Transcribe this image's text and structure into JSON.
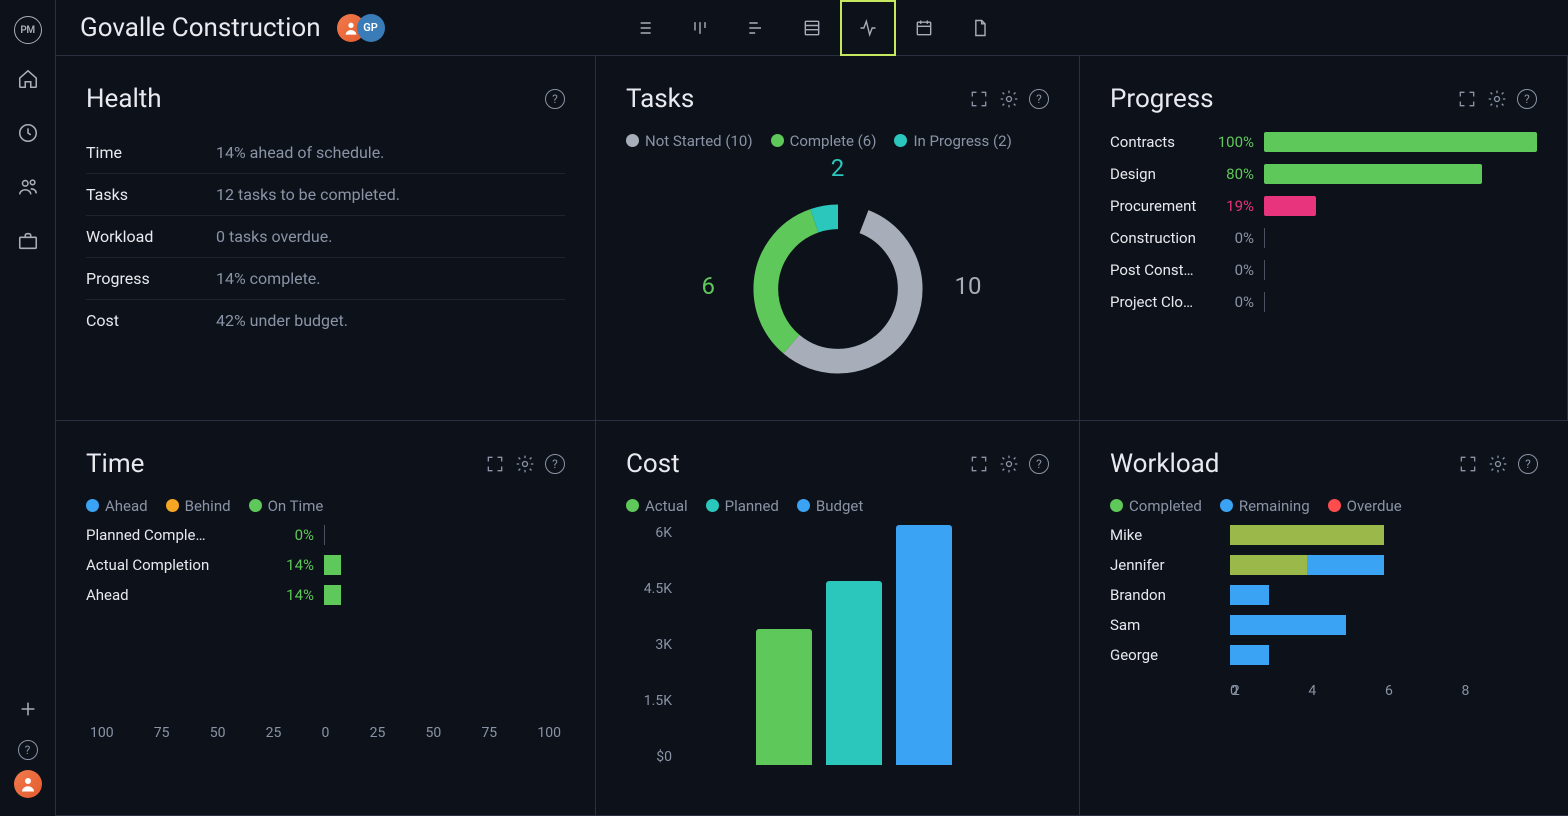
{
  "app": {
    "logo": "PM",
    "project_title": "Govalle Construction",
    "avatar2": "GP"
  },
  "colors": {
    "green": "#5fc85a",
    "teal": "#2bc6bc",
    "blue": "#3ba3f4",
    "pink": "#e8347c",
    "orange": "#f5a623",
    "red": "#ff4d4d",
    "grey": "#a8aeb9",
    "olive": "#9bb84a"
  },
  "health": {
    "title": "Health",
    "rows": [
      {
        "label": "Time",
        "value": "14% ahead of schedule."
      },
      {
        "label": "Tasks",
        "value": "12 tasks to be completed."
      },
      {
        "label": "Workload",
        "value": "0 tasks overdue."
      },
      {
        "label": "Progress",
        "value": "14% complete."
      },
      {
        "label": "Cost",
        "value": "42% under budget."
      }
    ]
  },
  "tasks": {
    "title": "Tasks",
    "legend": [
      {
        "label": "Not Started (10)",
        "color": "#a8aeb9"
      },
      {
        "label": "Complete (6)",
        "color": "#5fc85a"
      },
      {
        "label": "In Progress (2)",
        "color": "#2bc6bc"
      }
    ],
    "chart_data": {
      "type": "pie",
      "title": "Tasks",
      "series": [
        {
          "name": "Not Started",
          "value": 10,
          "color": "#a8aeb9"
        },
        {
          "name": "Complete",
          "value": 6,
          "color": "#5fc85a"
        },
        {
          "name": "In Progress",
          "value": 2,
          "color": "#2bc6bc"
        }
      ],
      "labels_shown": {
        "top": "2",
        "right": "10",
        "left": "6"
      }
    }
  },
  "progress": {
    "title": "Progress",
    "rows": [
      {
        "label": "Contracts",
        "pct": 100,
        "pct_label": "100%",
        "color": "#5fc85a"
      },
      {
        "label": "Design",
        "pct": 80,
        "pct_label": "80%",
        "color": "#5fc85a"
      },
      {
        "label": "Procurement",
        "pct": 19,
        "pct_label": "19%",
        "color": "#e8347c"
      },
      {
        "label": "Construction",
        "pct": 0,
        "pct_label": "0%",
        "color": null
      },
      {
        "label": "Post Const…",
        "pct": 0,
        "pct_label": "0%",
        "color": null
      },
      {
        "label": "Project Clo…",
        "pct": 0,
        "pct_label": "0%",
        "color": null
      }
    ]
  },
  "time": {
    "title": "Time",
    "legend": [
      {
        "label": "Ahead",
        "color": "#3ba3f4"
      },
      {
        "label": "Behind",
        "color": "#f5a623"
      },
      {
        "label": "On Time",
        "color": "#5fc85a"
      }
    ],
    "rows": [
      {
        "label": "Planned Comple…",
        "pct_label": "0%",
        "pct": 0
      },
      {
        "label": "Actual Completion",
        "pct_label": "14%",
        "pct": 14
      },
      {
        "label": "Ahead",
        "pct_label": "14%",
        "pct": 14
      }
    ],
    "axis": [
      "100",
      "75",
      "50",
      "25",
      "0",
      "25",
      "50",
      "75",
      "100"
    ],
    "chart_data": {
      "type": "bar",
      "categories": [
        "Planned Completion",
        "Actual Completion",
        "Ahead"
      ],
      "values": [
        0,
        14,
        14
      ],
      "xlim": [
        -100,
        100
      ],
      "xlabel": "",
      "ylabel": ""
    }
  },
  "cost": {
    "title": "Cost",
    "legend": [
      {
        "label": "Actual",
        "color": "#5fc85a"
      },
      {
        "label": "Planned",
        "color": "#2bc6bc"
      },
      {
        "label": "Budget",
        "color": "#3ba3f4"
      }
    ],
    "yticks": [
      "6K",
      "4.5K",
      "3K",
      "1.5K",
      "$0"
    ],
    "chart_data": {
      "type": "bar",
      "categories": [
        "Actual",
        "Planned",
        "Budget"
      ],
      "values": [
        3400,
        4600,
        6000
      ],
      "colors": [
        "#5fc85a",
        "#2bc6bc",
        "#3ba3f4"
      ],
      "ylim": [
        0,
        6000
      ],
      "ylabel": "",
      "xlabel": "",
      "title": "Cost"
    }
  },
  "workload": {
    "title": "Workload",
    "legend": [
      {
        "label": "Completed",
        "color": "#5fc85a"
      },
      {
        "label": "Remaining",
        "color": "#3ba3f4"
      },
      {
        "label": "Overdue",
        "color": "#ff4d4d"
      }
    ],
    "rows": [
      {
        "label": "Mike",
        "segments": [
          {
            "v": 4,
            "c": "#9bb84a"
          }
        ]
      },
      {
        "label": "Jennifer",
        "segments": [
          {
            "v": 2,
            "c": "#9bb84a"
          },
          {
            "v": 2,
            "c": "#3ba3f4"
          }
        ]
      },
      {
        "label": "Brandon",
        "segments": [
          {
            "v": 1,
            "c": "#3ba3f4"
          }
        ]
      },
      {
        "label": "Sam",
        "segments": [
          {
            "v": 3,
            "c": "#3ba3f4"
          }
        ]
      },
      {
        "label": "George",
        "segments": [
          {
            "v": 1,
            "c": "#3ba3f4"
          }
        ]
      }
    ],
    "axis": [
      "0",
      "2",
      "4",
      "6",
      "8"
    ],
    "chart_data": {
      "type": "bar",
      "title": "Workload",
      "x": [
        "Mike",
        "Jennifer",
        "Brandon",
        "Sam",
        "George"
      ],
      "series": [
        {
          "name": "Completed",
          "values": [
            4,
            2,
            0,
            0,
            0
          ]
        },
        {
          "name": "Remaining",
          "values": [
            0,
            2,
            1,
            3,
            1
          ]
        },
        {
          "name": "Overdue",
          "values": [
            0,
            0,
            0,
            0,
            0
          ]
        }
      ],
      "xlim": [
        0,
        8
      ]
    }
  }
}
